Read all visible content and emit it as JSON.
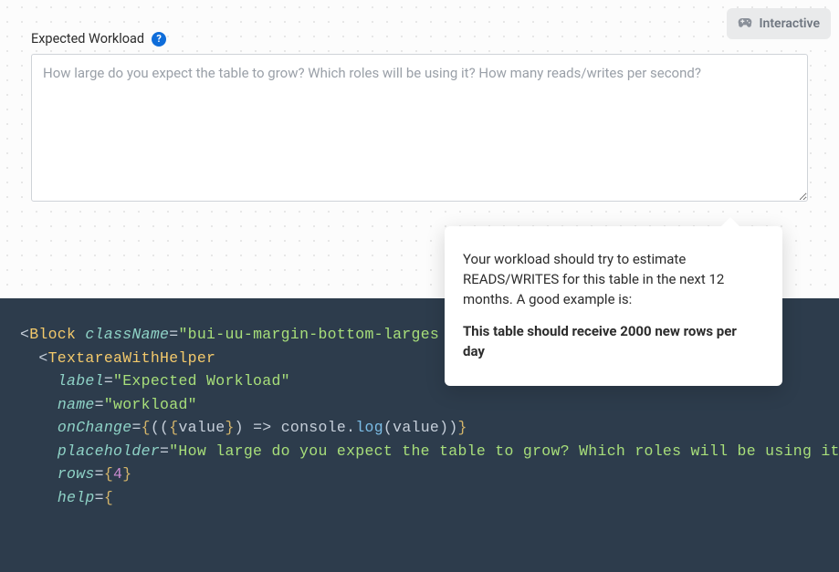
{
  "badge": {
    "label": "Interactive"
  },
  "form": {
    "label": "Expected Workload",
    "help_icon_text": "?",
    "placeholder": "How large do you expect the table to grow? Which roles will be using it? How many reads/writes per second?",
    "value": ""
  },
  "tooltip": {
    "text": "Your workload should try to estimate READS/WRITES for this table in the next 12 months. A good example is:",
    "bold": "This table should receive 2000 new rows per day"
  },
  "code": {
    "l1_open": "<",
    "l1_tag": "Block",
    "l1_attr": "className",
    "l1_eq": "=",
    "l1_val": "\"bui-uu-margin-bottom-larges",
    "l2_open": "<",
    "l2_tag": "TextareaWithHelper",
    "l3_attr": "label",
    "l3_eq": "=",
    "l3_val": "\"Expected Workload\"",
    "l4_attr": "name",
    "l4_eq": "=",
    "l4_val": "\"workload\"",
    "l5_attr": "onChange",
    "l5_eq": "=",
    "l5_b1": "{",
    "l5_p1": "((",
    "l5_b2": "{",
    "l5_arg": "value",
    "l5_b3": "}",
    "l5_p2": ")",
    "l5_arrow": " => ",
    "l5_obj": "console",
    "l5_dot": ".",
    "l5_fn": "log",
    "l5_p3": "(",
    "l5_arg2": "value",
    "l5_p4": ")",
    "l5_p5": ")",
    "l5_b4": "}",
    "l6_attr": "placeholder",
    "l6_eq": "=",
    "l6_val": "\"How large do you expect the table to grow? Which roles will be using it? How many reads/writes per second?\"",
    "l7_attr": "rows",
    "l7_eq": "=",
    "l7_b1": "{",
    "l7_num": "4",
    "l7_b2": "}",
    "l8_attr": "help",
    "l8_eq": "=",
    "l8_b1": "{"
  }
}
